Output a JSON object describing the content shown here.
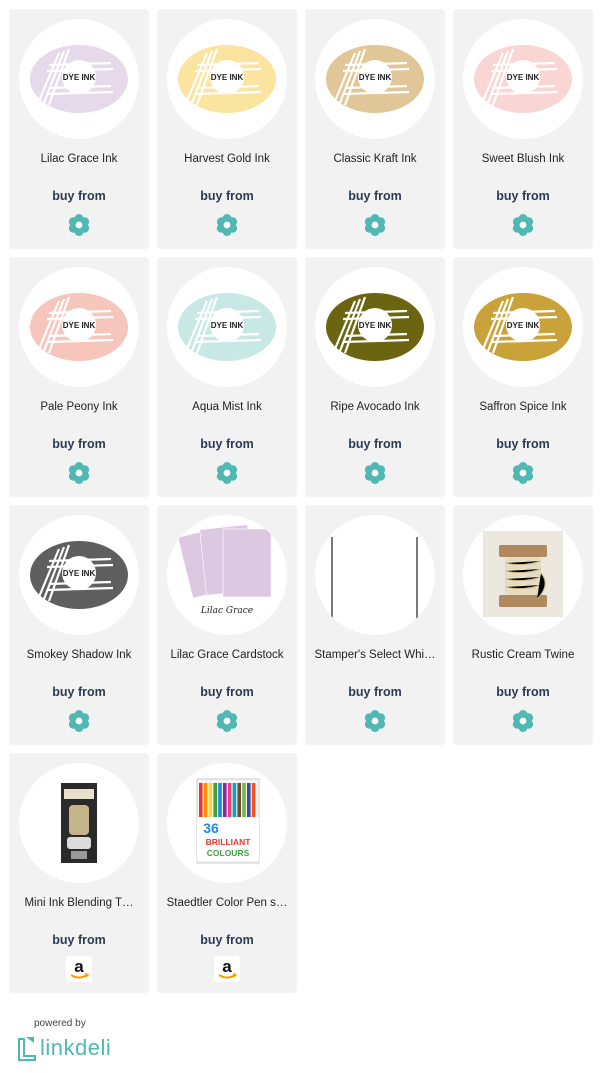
{
  "buy_label": "buy from",
  "products": [
    {
      "title": "Lilac Grace Ink",
      "kind": "ink",
      "color": "#e6d9ea",
      "store": "flower-store-icon"
    },
    {
      "title": "Harvest Gold Ink",
      "kind": "ink",
      "color": "#fbe3a0",
      "store": "flower-store-icon"
    },
    {
      "title": "Classic Kraft Ink",
      "kind": "ink",
      "color": "#e1c697",
      "store": "flower-store-icon"
    },
    {
      "title": "Sweet Blush Ink",
      "kind": "ink",
      "color": "#f9d6d3",
      "store": "flower-store-icon"
    },
    {
      "title": "Pale Peony Ink",
      "kind": "ink",
      "color": "#f6c5bb",
      "store": "flower-store-icon"
    },
    {
      "title": "Aqua Mist Ink",
      "kind": "ink",
      "color": "#c8e8e6",
      "store": "flower-store-icon"
    },
    {
      "title": "Ripe Avocado Ink",
      "kind": "ink",
      "color": "#6b6410",
      "store": "flower-store-icon"
    },
    {
      "title": "Saffron Spice Ink",
      "kind": "ink",
      "color": "#c9a23a",
      "store": "flower-store-icon"
    },
    {
      "title": "Smokey Shadow Ink",
      "kind": "ink",
      "color": "#5f5f5f",
      "store": "flower-store-icon"
    },
    {
      "title": "Lilac Grace Cardstock",
      "kind": "cardstock",
      "color": "#ddc8e2",
      "store": "flower-store-icon"
    },
    {
      "title": "Stamper's Select Whi…",
      "kind": "whitecard",
      "color": "#ffffff",
      "store": "flower-store-icon"
    },
    {
      "title": "Rustic Cream Twine",
      "kind": "twine",
      "color": "#efe6d2",
      "store": "flower-store-icon"
    },
    {
      "title": "Mini Ink Blending T…",
      "kind": "tool",
      "color": "#2b2b2b",
      "store": "amazon-store-icon"
    },
    {
      "title": "Staedtler Color Pen s…",
      "kind": "pens",
      "color": "#3aa0d8",
      "store": "amazon-store-icon"
    }
  ],
  "labels": {
    "ink_brand": "DYE INK",
    "cardstock_caption": "Lilac Grace",
    "pens_big": "36",
    "pens_word1": "BRILLIANT",
    "pens_word2": "COLOURS",
    "amazon_letter": "a"
  },
  "footer": {
    "powered_by": "powered by",
    "logo": "linkdeli"
  },
  "colors": {
    "card_bg": "#f2f2f2",
    "buy_text": "#2b3a55",
    "accent": "#4fb8b2"
  }
}
